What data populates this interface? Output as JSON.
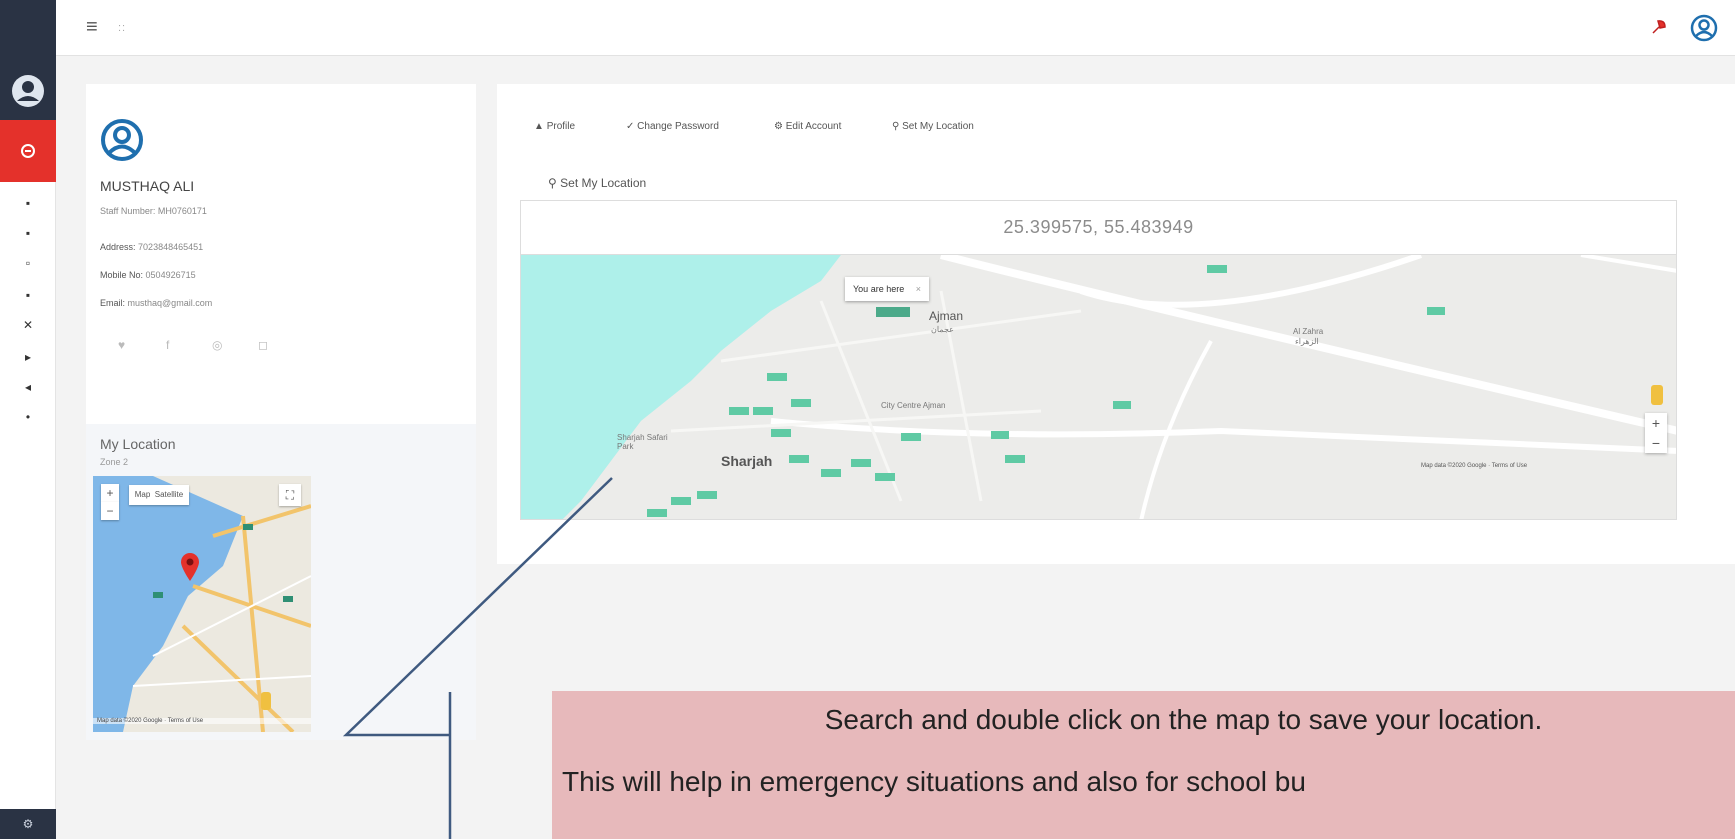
{
  "app": {
    "top_left_icon": "menu-icon",
    "grid_glyph": "::"
  },
  "profile": {
    "name": "MUSTHAQ ALI",
    "staff_line": "Staff Number: MH0760171",
    "address_label": "Address:",
    "address_value": "7023848465451",
    "mobile_label": "Mobile No:",
    "mobile_value": "0504926715",
    "email_label": "Email:",
    "email_value": "musthaq@gmail.com"
  },
  "my_location": {
    "title": "My Location",
    "subtitle": "Zone 2",
    "map_type_labels": [
      "Map",
      "Satellite"
    ],
    "attribution": "Map data ©2020 Google · Terms of Use"
  },
  "tabs": [
    {
      "label": "Profile",
      "icon": "user-icon"
    },
    {
      "label": "Change Password",
      "icon": "check-icon"
    },
    {
      "label": "Edit Account",
      "icon": "gear-icon"
    },
    {
      "label": "Set My Location",
      "icon": "pin-icon"
    }
  ],
  "set_location": {
    "heading": "Set My Location",
    "coordinates": "25.399575, 55.483949",
    "popup_text": "You are here",
    "place_labels": {
      "ajman": "Ajman",
      "ajman_ar": "عجمان",
      "sharjah": "Sharjah",
      "al_zahra": "Al Zahra",
      "al_zahra_ar": "الزهراء",
      "city_centre": "City Centre Ajman",
      "sharjah_park": "Sharjah Safari Park"
    },
    "attribution": "Map data ©2020 Google · Terms of Use"
  },
  "callout": {
    "line1": "Search and double click on the map to save your location.",
    "line2": "This will help in emergency situations and also for school bu"
  },
  "colors": {
    "sidebar_dark": "#2a3344",
    "accent_red": "#e4312b",
    "map_water": "#aef0ea",
    "callout_bg": "#e7b9bb",
    "leader_line": "#3f5a80"
  }
}
